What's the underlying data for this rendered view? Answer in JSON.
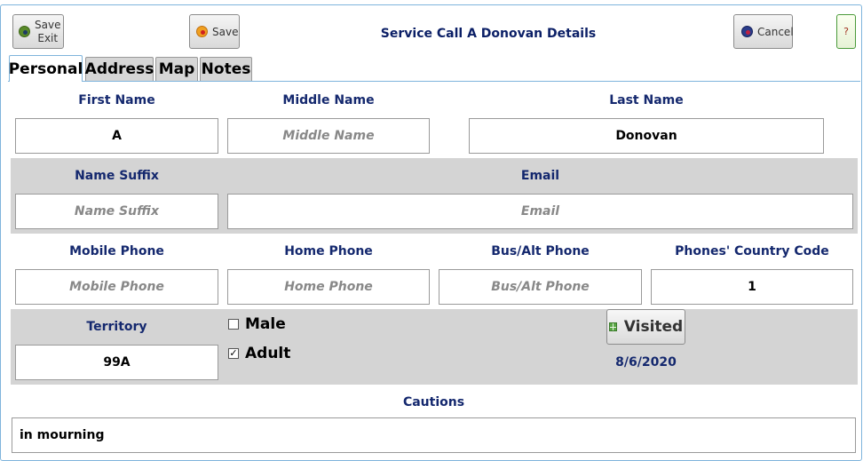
{
  "toolbar": {
    "save_exit_line1": "Save",
    "save_exit_line2": "Exit",
    "save_label": "Save",
    "cancel_label": "Cancel",
    "help_label": "?"
  },
  "title": "Service Call A Donovan Details",
  "tabs": [
    {
      "label": "Personal",
      "active": true
    },
    {
      "label": "Address",
      "active": false
    },
    {
      "label": "Map",
      "active": false
    },
    {
      "label": "Notes",
      "active": false
    }
  ],
  "form": {
    "first_name": {
      "label": "First Name",
      "value": "A"
    },
    "middle_name": {
      "label": "Middle Name",
      "placeholder": "Middle Name"
    },
    "last_name": {
      "label": "Last Name",
      "value": "Donovan"
    },
    "name_suffix": {
      "label": "Name Suffix",
      "placeholder": "Name Suffix"
    },
    "email": {
      "label": "Email",
      "placeholder": "Email"
    },
    "mobile_phone": {
      "label": "Mobile Phone",
      "placeholder": "Mobile Phone"
    },
    "home_phone": {
      "label": "Home Phone",
      "placeholder": "Home Phone"
    },
    "bus_alt_phone": {
      "label": "Bus/Alt Phone",
      "placeholder": "Bus/Alt Phone"
    },
    "country_code": {
      "label": "Phones' Country Code",
      "value": "1"
    },
    "territory": {
      "label": "Territory",
      "value": "99A"
    },
    "male": {
      "label": "Male",
      "checked": false
    },
    "adult": {
      "label": "Adult",
      "checked": true,
      "mark": "✓"
    },
    "visited": {
      "label": "Visited",
      "date": "8/6/2020"
    },
    "cautions": {
      "label": "Cautions",
      "value": "in mourning"
    }
  },
  "colors": {
    "label_text": "#14286e",
    "band_gray": "#d4d4d4",
    "border_blue": "#7fb4dc"
  },
  "icons": {
    "save_exit": "green-dot-icon",
    "save": "orange-dot-icon",
    "cancel": "navy-dot-icon",
    "visited": "calendar-icon"
  }
}
